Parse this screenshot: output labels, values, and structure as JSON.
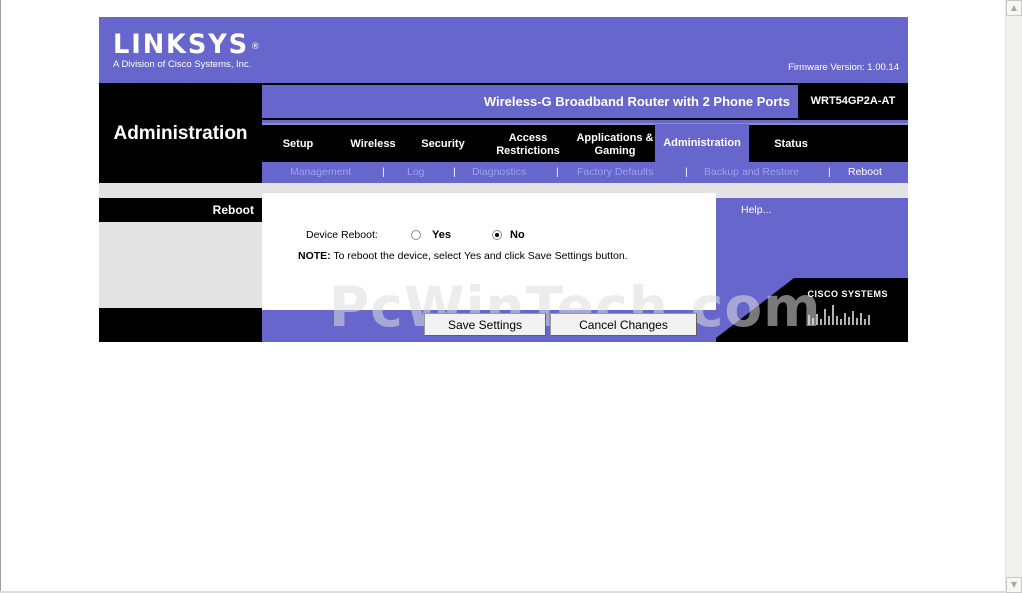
{
  "brand": {
    "logo": "LINKSYS",
    "registered_mark": "®",
    "tagline": "A Division of Cisco Systems, Inc.",
    "firmware": "Firmware Version: 1.00.14"
  },
  "section_title": "Administration",
  "product": {
    "name": "Wireless-G Broadband Router with 2 Phone Ports",
    "model": "WRT54GP2A-AT"
  },
  "tabs": [
    {
      "label": "Setup"
    },
    {
      "label": "Wireless"
    },
    {
      "label": "Security"
    },
    {
      "label": "Access Restrictions"
    },
    {
      "label": "Applications & Gaming"
    },
    {
      "label": "Administration",
      "active": true
    },
    {
      "label": "Status"
    }
  ],
  "subnav": [
    {
      "label": "Management"
    },
    {
      "label": "Log"
    },
    {
      "label": "Diagnostics"
    },
    {
      "label": "Factory Defaults"
    },
    {
      "label": "Backup and Restore"
    },
    {
      "label": "Reboot",
      "active": true
    }
  ],
  "separator": "|",
  "left_label": "Reboot",
  "form": {
    "device_reboot_label": "Device Reboot:",
    "option_yes": "Yes",
    "option_no": "No",
    "selected": "No",
    "note_prefix": "NOTE:",
    "note_text": " To reboot the device, select Yes and click Save Settings button."
  },
  "help_link": "Help...",
  "cisco_logo_text": "CISCO SYSTEMS",
  "buttons": {
    "save": "Save Settings",
    "cancel": "Cancel Changes"
  },
  "watermark": "PcWinTech.com",
  "colors": {
    "brand_purple": "#6666cc",
    "inactive_subnav": "#9da2ef"
  }
}
